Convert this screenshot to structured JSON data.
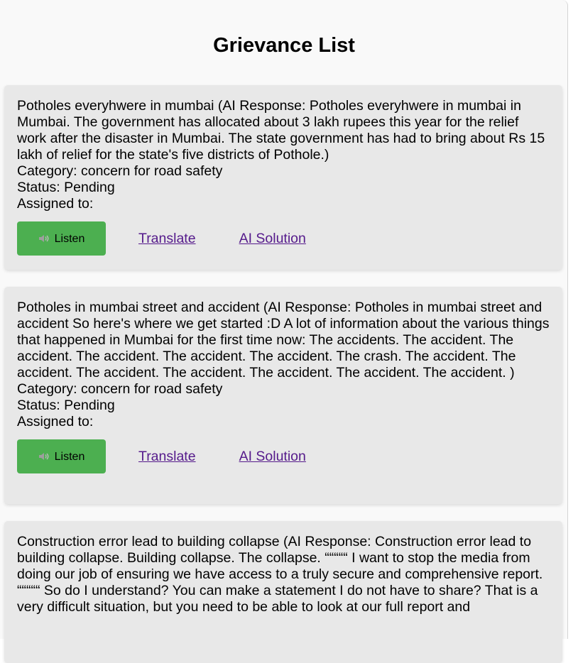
{
  "page": {
    "title": "Grievance List"
  },
  "labels": {
    "category": "Category: ",
    "status": "Status: ",
    "assigned": "Assigned to:",
    "listen": "Listen",
    "translate": "Translate",
    "ai_solution": "AI Solution"
  },
  "grievances": [
    {
      "description": "Potholes everyhwere in mumbai (AI Response: Potholes everyhwere in mumbai in Mumbai. The government has allocated about 3 lakh rupees this year for the relief work after the disaster in Mumbai. The state government has had to bring about Rs 15 lakh of relief for the state's five districts of Pothole.)",
      "category": "concern for road safety",
      "status": "Pending",
      "assigned_to": ""
    },
    {
      "description": "Potholes in mumbai street and accident (AI Response: Potholes in mumbai street and accident So here's where we get started :D A lot of information about the various things that happened in Mumbai for the first time now: The accidents. The accident. The accident. The accident. The accident. The accident. The crash. The accident. The accident. The accident. The accident. The accident. The accident. The accident. )",
      "category": "concern for road safety",
      "status": "Pending",
      "assigned_to": ""
    },
    {
      "description": "Construction error lead to building collapse (AI Response: Construction error lead to building collapse. Building collapse. The collapse. “““““ I want to stop the media from doing our job of ensuring we have access to a truly secure and comprehensive report. “““““ So do I understand? You can make a statement I do not have to share? That is a very difficult situation, but you need to be able to look at our full report and"
    }
  ]
}
